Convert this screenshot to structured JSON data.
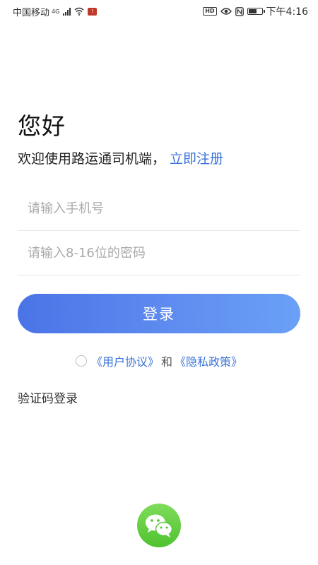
{
  "status_bar": {
    "carrier": "中国移动",
    "network": "4G",
    "notif": "!",
    "hd": "HD",
    "time": "下午4:16"
  },
  "login": {
    "greeting": "您好",
    "welcome": "欢迎使用路运通司机端，",
    "register_link": "立即注册",
    "phone_placeholder": "请输入手机号",
    "password_placeholder": "请输入8-16位的密码",
    "login_button": "登录",
    "agreement_user": "《用户协议》",
    "agreement_and": "和",
    "agreement_privacy": "《隐私政策》",
    "sms_login": "验证码登录"
  },
  "colors": {
    "link": "#3a73d6",
    "button_start": "#4a74e6",
    "button_end": "#6aa0f6",
    "wechat": "#5cc83b"
  },
  "icons": {
    "wechat": "wechat-icon",
    "radio": "radio-unchecked-icon"
  }
}
